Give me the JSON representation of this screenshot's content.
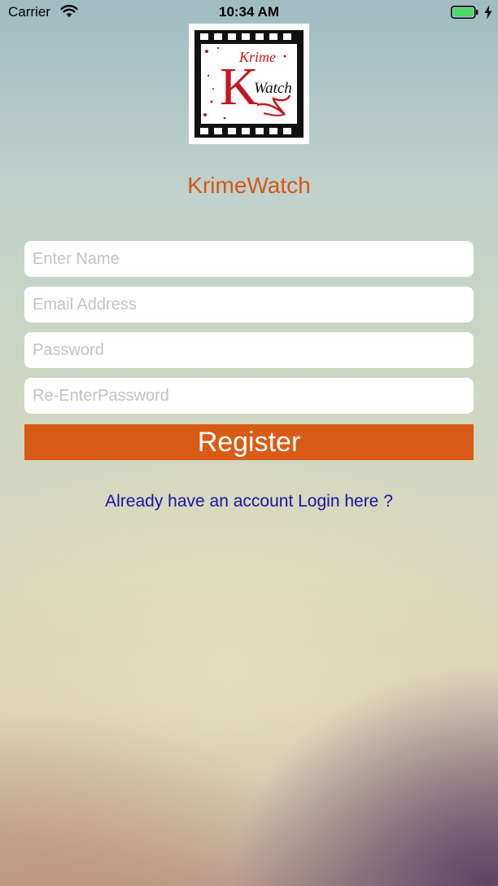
{
  "status_bar": {
    "carrier": "Carrier",
    "time": "10:34 AM"
  },
  "logo": {
    "text_top": "Krime",
    "text_initial": "K",
    "text_bottom": "Watch"
  },
  "app_title": "KrimeWatch",
  "form": {
    "name_placeholder": "Enter Name",
    "email_placeholder": "Email Address",
    "password_placeholder": "Password",
    "reenter_password_placeholder": "Re-EnterPassword",
    "register_label": "Register"
  },
  "login_link": "Already have an account Login here ?",
  "colors": {
    "accent": "#d95b16",
    "title": "#d4571a",
    "link": "#1515a6",
    "battery": "#4cd964"
  }
}
